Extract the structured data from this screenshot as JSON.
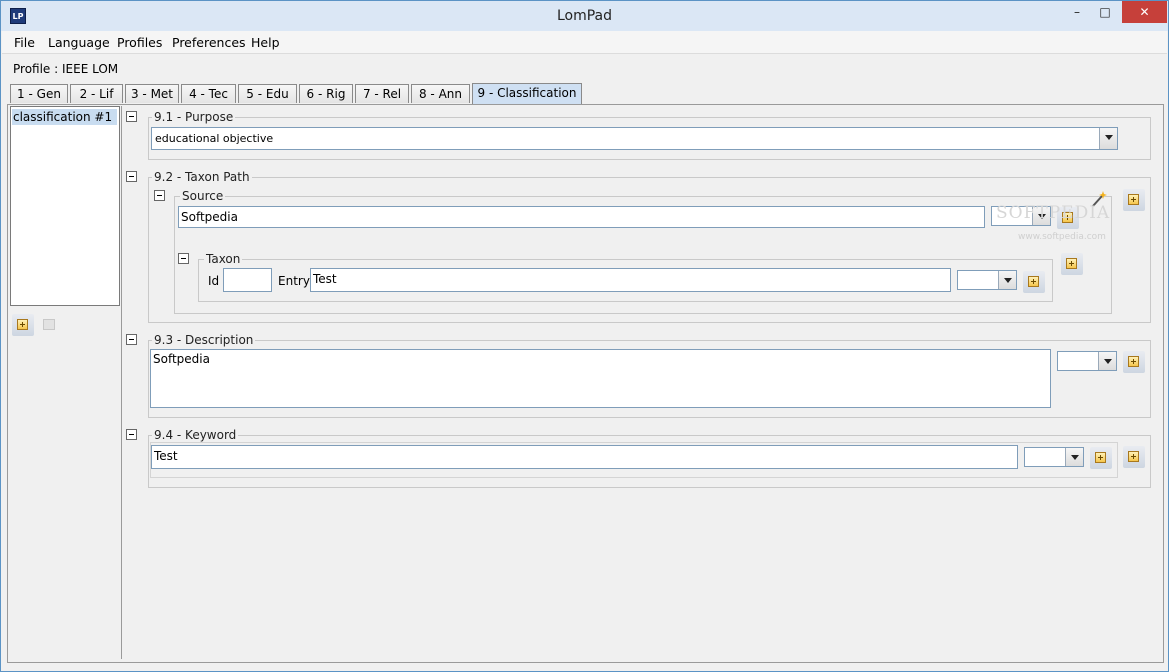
{
  "window": {
    "title": "LomPad",
    "icon_text": "LP"
  },
  "window_controls": {
    "minimize": "–",
    "maximize": "□",
    "close": "✕"
  },
  "menu": [
    "File",
    "Language",
    "Profiles",
    "Preferences",
    "Help"
  ],
  "profile_text": "Profile : IEEE LOM",
  "tabs": [
    "1 - Gen",
    "2 - Lif",
    "3 - Met",
    "4 - Tec",
    "5 - Edu",
    "6 - Rig",
    "7 - Rel",
    "8 - Ann",
    "9 - Classification"
  ],
  "active_tab": "9 - Classification",
  "left_list": {
    "items": [
      "classification #1"
    ]
  },
  "purpose": {
    "label": "9.1 - Purpose",
    "value": "educational objective"
  },
  "taxon_path": {
    "label": "9.2 - Taxon Path",
    "source": {
      "label": "Source",
      "value": "Softpedia"
    },
    "taxon": {
      "label": "Taxon",
      "id_label": "Id",
      "id_value": "",
      "entry_label": "Entry",
      "entry_value": "Test"
    }
  },
  "description": {
    "label": "9.3 - Description",
    "value": "Softpedia"
  },
  "keyword": {
    "label": "9.4 - Keyword",
    "value": "Test"
  },
  "watermark": {
    "text": "SOFTPEDIA",
    "url": "www.softpedia.com"
  },
  "icons": {
    "add": "plus-box-icon",
    "remove": "minus-box-icon",
    "collapse": "collapse-minus-icon",
    "dropdown": "chevron-down-icon",
    "wand": "magic-wand-icon"
  },
  "colors": {
    "title_bg": "#dbe7f5",
    "close_btn": "#c6403a",
    "selection": "#c8dcf0",
    "active_tab": "#cfe0f3"
  }
}
